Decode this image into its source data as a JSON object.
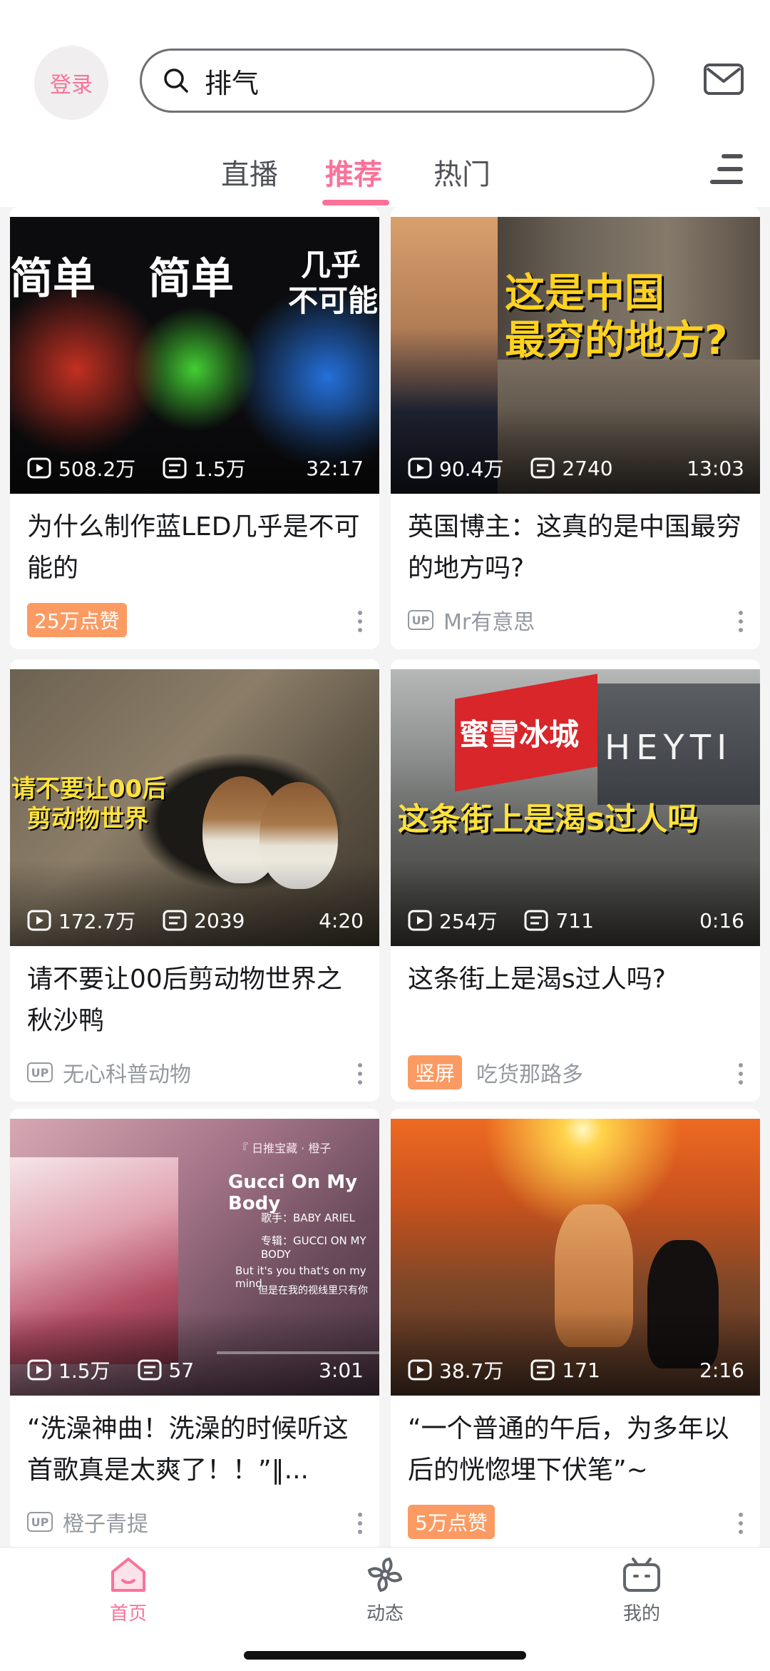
{
  "header": {
    "login_label": "登录",
    "search_value": "排气",
    "tabs": [
      {
        "label": "直播"
      },
      {
        "label": "推荐"
      },
      {
        "label": "热门"
      }
    ],
    "active_tab": "推荐"
  },
  "cards": [
    {
      "views": "508.2万",
      "comments": "1.5万",
      "duration": "32:17",
      "title": "为什么制作蓝LED几乎是不可能的",
      "badge": "25万点赞",
      "author": "",
      "thumb_text": [
        "简单",
        "简单",
        "几乎",
        "不可能"
      ]
    },
    {
      "views": "90.4万",
      "comments": "2740",
      "duration": "13:03",
      "title": "英国博主：这真的是中国最穷的地方吗?",
      "badge": "",
      "author": "Mr有意思",
      "thumb_text": [
        "这是中国",
        "最穷的地方?"
      ]
    },
    {
      "views": "172.7万",
      "comments": "2039",
      "duration": "4:20",
      "title": "请不要让00后剪动物世界之秋沙鸭",
      "badge": "",
      "author": "无心科普动物",
      "thumb_text": [
        "请不要让00后",
        "剪动物世界"
      ]
    },
    {
      "views": "254万",
      "comments": "711",
      "duration": "0:16",
      "title": "这条街上是渴s过人吗?",
      "badge": "竖屏",
      "author": "吃货那路多",
      "thumb_text": [
        "这条街上是渴s过人吗",
        "蜜雪冰城",
        "HEYTI"
      ]
    },
    {
      "views": "1.5万",
      "comments": "57",
      "duration": "3:01",
      "title": "“洗澡神曲！洗澡的时候听这首歌真是太爽了！！”‖...",
      "badge": "",
      "author": "橙子青提",
      "thumb_text": [
        "『 日推宝藏 · 橙子",
        "Gucci On My Body",
        "歌手：BABY ARIEL",
        "专辑：GUCCI ON MY BODY",
        "But it's you that's on my mind",
        "但是在我的视线里只有你"
      ]
    },
    {
      "views": "38.7万",
      "comments": "171",
      "duration": "2:16",
      "title": "“一个普通的午后，为多年以后的恍惚埋下伏笔”~",
      "badge": "5万点赞",
      "author": "",
      "thumb_text": []
    }
  ],
  "up_label": "UP",
  "bottom_nav": [
    {
      "label": "首页",
      "icon": "home-icon"
    },
    {
      "label": "动态",
      "icon": "pinwheel-icon"
    },
    {
      "label": "我的",
      "icon": "tv-icon"
    }
  ],
  "colors": {
    "accent": "#fb7299",
    "badge": "#fb9b63",
    "text": "#18191c",
    "muted": "#9499a0"
  }
}
